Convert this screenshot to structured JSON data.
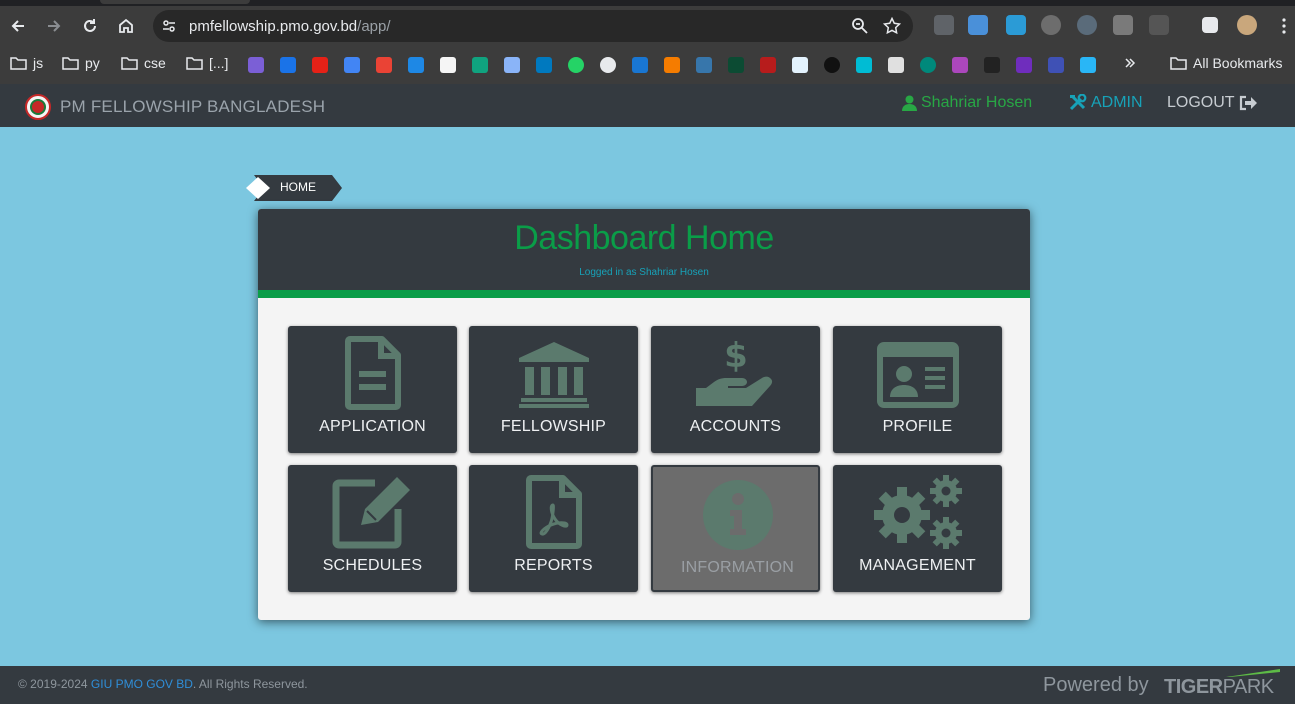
{
  "browser": {
    "url_host": "pmfellowship.pmo.gov.bd",
    "url_path": "/app/",
    "bookmarks": [
      "js",
      "py",
      "cse",
      "[...]"
    ],
    "all_bookmarks_label": "All Bookmarks"
  },
  "navbar": {
    "brand": "PM FELLOWSHIP BANGLADESH",
    "user": "Shahriar Hosen",
    "admin": "ADMIN",
    "logout": "LOGOUT"
  },
  "breadcrumb": {
    "home": "HOME"
  },
  "dashboard": {
    "title": "Dashboard Home",
    "subtitle": "Logged in as Shahriar Hosen",
    "tiles": [
      {
        "label": "APPLICATION",
        "icon": "file-icon",
        "enabled": true
      },
      {
        "label": "FELLOWSHIP",
        "icon": "bank-icon",
        "enabled": true
      },
      {
        "label": "ACCOUNTS",
        "icon": "hand-dollar-icon",
        "enabled": true
      },
      {
        "label": "PROFILE",
        "icon": "id-card-icon",
        "enabled": true
      },
      {
        "label": "SCHEDULES",
        "icon": "edit-icon",
        "enabled": true
      },
      {
        "label": "REPORTS",
        "icon": "pdf-file-icon",
        "enabled": true
      },
      {
        "label": "INFORMATION",
        "icon": "info-icon",
        "enabled": false
      },
      {
        "label": "MANAGEMENT",
        "icon": "gears-icon",
        "enabled": true
      }
    ]
  },
  "footer": {
    "copyright_prefix": "© 2019-2024",
    "copyright_link": "GIU PMO GOV BD",
    "copyright_suffix": ". All Rights Reserved.",
    "powered_by": "Powered by",
    "vendor_bold": "TIGER",
    "vendor_light": "PARK"
  },
  "colors": {
    "accent_green": "#0a9d48",
    "navbar": "#343a40",
    "page_bg": "#7cc7e0",
    "icon_green": "#5b7a6d",
    "admin_blue": "#17a2b8"
  }
}
